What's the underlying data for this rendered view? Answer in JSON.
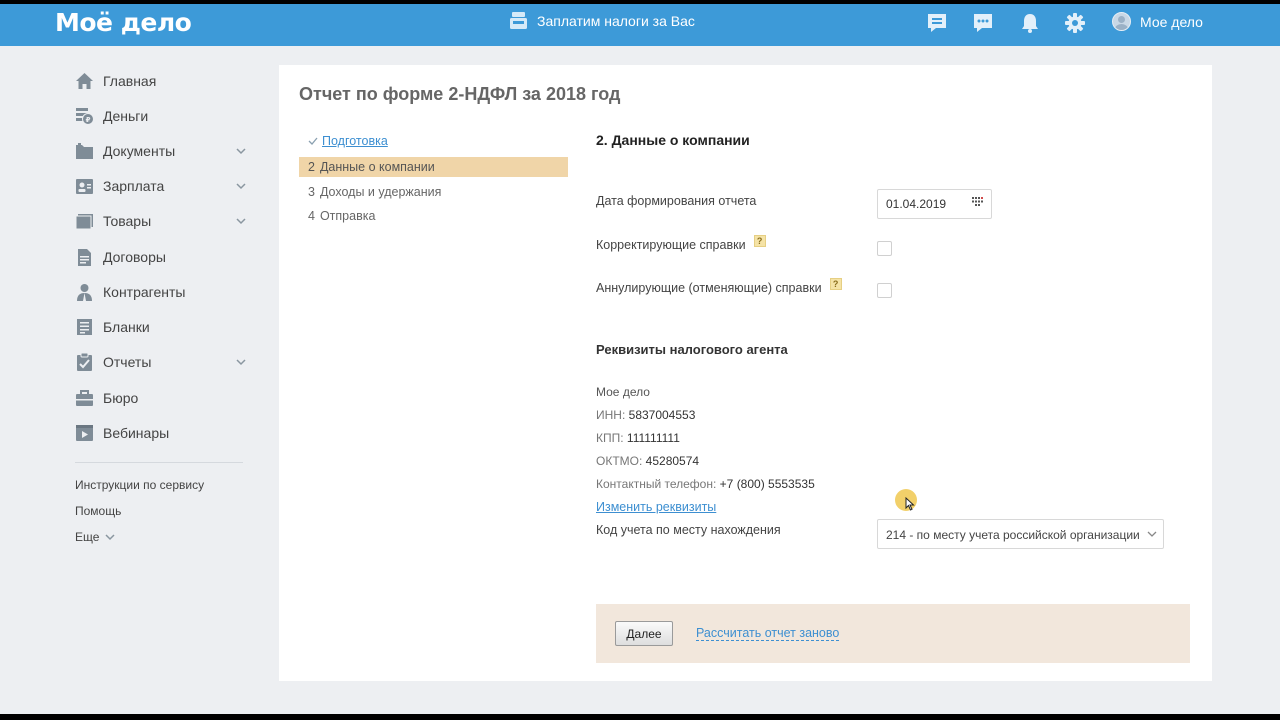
{
  "header": {
    "logo": "Моё дело",
    "promo": "Заплатим налоги за Вас",
    "user_name": "Мое дело",
    "icons": [
      "chat-icon",
      "messages-icon",
      "bell-icon",
      "gear-icon"
    ],
    "accent_color": "#3d9ad8"
  },
  "sidebar": {
    "items": [
      {
        "label": "Главная",
        "icon": "home-icon",
        "has_submenu": false
      },
      {
        "label": "Деньги",
        "icon": "money-icon",
        "has_submenu": false
      },
      {
        "label": "Документы",
        "icon": "folder-icon",
        "has_submenu": true
      },
      {
        "label": "Зарплата",
        "icon": "salary-icon",
        "has_submenu": true
      },
      {
        "label": "Товары",
        "icon": "goods-icon",
        "has_submenu": true
      },
      {
        "label": "Договоры",
        "icon": "contract-icon",
        "has_submenu": false
      },
      {
        "label": "Контрагенты",
        "icon": "contractors-icon",
        "has_submenu": false
      },
      {
        "label": "Бланки",
        "icon": "forms-icon",
        "has_submenu": false
      },
      {
        "label": "Отчеты",
        "icon": "reports-icon",
        "has_submenu": true
      },
      {
        "label": "Бюро",
        "icon": "bureau-icon",
        "has_submenu": false
      },
      {
        "label": "Вебинары",
        "icon": "webinar-icon",
        "has_submenu": false
      }
    ],
    "instructions": "Инструкции по сервису",
    "help": "Помощь",
    "more": "Еще"
  },
  "main": {
    "title": "Отчет по форме 2-НДФЛ за 2018 год",
    "steps": [
      {
        "num": "",
        "label": "Подготовка",
        "state": "done"
      },
      {
        "num": "2",
        "label": "Данные о компании",
        "state": "active"
      },
      {
        "num": "3",
        "label": "Доходы и удержания",
        "state": "pending"
      },
      {
        "num": "4",
        "label": "Отправка",
        "state": "pending"
      }
    ],
    "section_title": "2. Данные о компании",
    "report_date_label": "Дата формирования отчета",
    "report_date": "01.04.2019",
    "corrective_label": "Корректирующие справки",
    "corrective_checked": false,
    "annulling_label": "Аннулирующие (отменяющие) справки",
    "annulling_checked": false,
    "help_mark": "?",
    "agent_title": "Реквизиты налогового агента",
    "company_name": "Мое дело",
    "inn_label": "ИНН:",
    "inn": "5837004553",
    "kpp_label": "КПП:",
    "kpp": "111111111",
    "oktmo_label": "ОКТМО:",
    "oktmo": "45280574",
    "phone_label": "Контактный телефон:",
    "phone": "+7 (800) 5553535",
    "edit_link": "Изменить реквизиты",
    "location_code_label": "Код учета по месту нахождения",
    "location_code": "214 - по месту учета российской организации",
    "next_button": "Далее",
    "recalc_link": "Рассчитать отчет заново"
  }
}
